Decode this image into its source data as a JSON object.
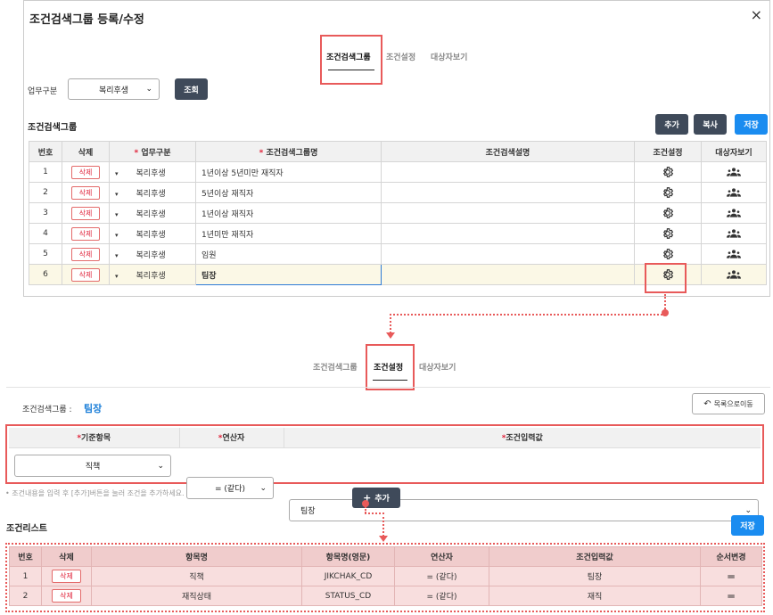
{
  "modal": {
    "title": "조건검색그룹 등록/수정",
    "close": "×",
    "tabs": [
      "조건검색그룹",
      "조건설정",
      "대상자보기"
    ],
    "filter_label": "업무구분",
    "filter_value": "복리후생",
    "search_button": "조회",
    "section_title": "조건검색그룹",
    "add_button": "추가",
    "copy_button": "복사",
    "save_button": "저장",
    "columns": [
      "번호",
      "삭제",
      "업무구분",
      "조건검색그룹명",
      "조건검색설명",
      "조건설정",
      "대상자보기"
    ],
    "required_mark": "*",
    "delete_label": "삭제",
    "rows": [
      {
        "no": "1",
        "biz": "복리후생",
        "name": "1년이상 5년미만 재직자",
        "desc": ""
      },
      {
        "no": "2",
        "biz": "복리후생",
        "name": "5년이상 재직자",
        "desc": ""
      },
      {
        "no": "3",
        "biz": "복리후생",
        "name": "1년이상 재직자",
        "desc": ""
      },
      {
        "no": "4",
        "biz": "복리후생",
        "name": "1년미만 재직자",
        "desc": ""
      },
      {
        "no": "5",
        "biz": "복리후생",
        "name": "임원",
        "desc": ""
      },
      {
        "no": "6",
        "biz": "복리후생",
        "name": "팀장",
        "desc": ""
      }
    ]
  },
  "condition": {
    "tabs": [
      "조건검색그룹",
      "조건설정",
      "대상자보기"
    ],
    "group_label": "조건검색그룹 :",
    "group_value": "팀장",
    "back_button": "목록으로이동",
    "columns": [
      "기준항목",
      "연산자",
      "조건입력값"
    ],
    "std_value": "직책",
    "op_value": "= (같다)",
    "input_value": "팀장",
    "hint": "• 조건내용을 입력 후 [추가]버튼을 눌러 조건을 추가하세요.",
    "add_button": "추가",
    "list_title": "조건리스트",
    "save_button": "저장",
    "list_columns": [
      "번호",
      "삭제",
      "항목명",
      "항목명(영문)",
      "연산자",
      "조건입력값",
      "순서변경"
    ],
    "list_rows": [
      {
        "no": "1",
        "name": "직책",
        "en": "JIKCHAK_CD",
        "op": "= (같다)",
        "val": "팀장"
      },
      {
        "no": "2",
        "name": "재직상태",
        "en": "STATUS_CD",
        "op": "= (같다)",
        "val": "재직"
      }
    ],
    "delete_label": "삭제"
  },
  "colors": {
    "accent": "#1a8cf0",
    "highlight": "#e85a5a",
    "dark_button": "#3f4a5a"
  }
}
